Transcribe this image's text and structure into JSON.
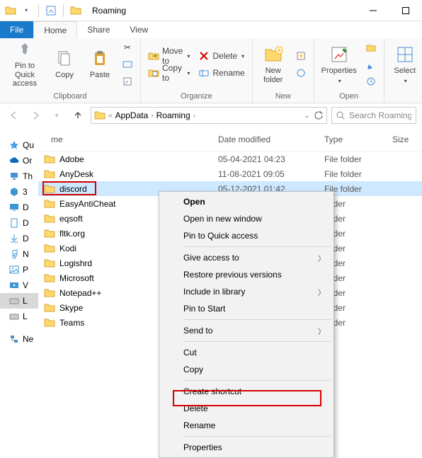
{
  "window": {
    "title": "Roaming"
  },
  "tabs": {
    "file": "File",
    "home": "Home",
    "share": "Share",
    "view": "View"
  },
  "ribbon": {
    "clipboard": {
      "label": "Clipboard",
      "pin": "Pin to Quick\naccess",
      "copy": "Copy",
      "paste": "Paste"
    },
    "organize": {
      "label": "Organize",
      "move": "Move to",
      "copyto": "Copy to",
      "delete": "Delete",
      "rename": "Rename"
    },
    "new": {
      "label": "New",
      "folder": "New\nfolder"
    },
    "open": {
      "label": "Open",
      "properties": "Properties"
    },
    "select": {
      "label": "Select"
    }
  },
  "breadcrumb": {
    "p1": "AppData",
    "p2": "Roaming"
  },
  "search": {
    "placeholder": "Search Roaming"
  },
  "columns": {
    "name": "me",
    "date": "Date modified",
    "type": "Type",
    "size": "Size"
  },
  "folders": [
    {
      "name": "Adobe",
      "date": "05-04-2021 04:23",
      "type": "File folder"
    },
    {
      "name": "AnyDesk",
      "date": "11-08-2021 09:05",
      "type": "File folder"
    },
    {
      "name": "discord",
      "date": "05-12-2021 01:42",
      "type": "File folder",
      "selected": true,
      "highlighted": true
    },
    {
      "name": "EasyAntiCheat",
      "date": "",
      "type": "folder"
    },
    {
      "name": "eqsoft",
      "date": "",
      "type": "folder"
    },
    {
      "name": "fltk.org",
      "date": "",
      "type": "folder"
    },
    {
      "name": "Kodi",
      "date": "",
      "type": "folder"
    },
    {
      "name": "Logishrd",
      "date": "",
      "type": "folder"
    },
    {
      "name": "Microsoft",
      "date": "",
      "type": "folder"
    },
    {
      "name": "Notepad++",
      "date": "",
      "type": "folder"
    },
    {
      "name": "Skype",
      "date": "",
      "type": "folder"
    },
    {
      "name": "Teams",
      "date": "",
      "type": "folder"
    }
  ],
  "navpane": [
    {
      "label": "Qu",
      "icon": "star",
      "color": "#4aa0e8"
    },
    {
      "label": "Or",
      "icon": "cloud",
      "color": "#0f6cbd"
    },
    {
      "label": "Th",
      "icon": "pc",
      "color": "#4a90d9"
    },
    {
      "label": "3",
      "icon": "cube",
      "color": "#3b97d3"
    },
    {
      "label": "D",
      "icon": "desktop",
      "color": "#3b97d3"
    },
    {
      "label": "D",
      "icon": "doc",
      "color": "#3b97d3"
    },
    {
      "label": "D",
      "icon": "download",
      "color": "#3b97d3"
    },
    {
      "label": "N",
      "icon": "music",
      "color": "#3b97d3"
    },
    {
      "label": "P",
      "icon": "picture",
      "color": "#3b97d3"
    },
    {
      "label": "V",
      "icon": "video",
      "color": "#3b97d3"
    },
    {
      "label": "L",
      "icon": "disk",
      "color": "#888",
      "selected": true
    },
    {
      "label": "L",
      "icon": "disk",
      "color": "#888"
    },
    {
      "label": "Ne",
      "icon": "network",
      "color": "#4a90d9",
      "spacer": true
    }
  ],
  "context_menu": [
    {
      "label": "Open",
      "bold": true
    },
    {
      "label": "Open in new window"
    },
    {
      "label": "Pin to Quick access"
    },
    {
      "sep": true
    },
    {
      "label": "Give access to",
      "submenu": true
    },
    {
      "label": "Restore previous versions"
    },
    {
      "label": "Include in library",
      "submenu": true
    },
    {
      "label": "Pin to Start"
    },
    {
      "sep": true
    },
    {
      "label": "Send to",
      "submenu": true
    },
    {
      "sep": true
    },
    {
      "label": "Cut"
    },
    {
      "label": "Copy"
    },
    {
      "sep": true
    },
    {
      "label": "Create shortcut"
    },
    {
      "label": "Delete",
      "highlighted": true
    },
    {
      "label": "Rename"
    },
    {
      "sep": true
    },
    {
      "label": "Properties"
    }
  ]
}
